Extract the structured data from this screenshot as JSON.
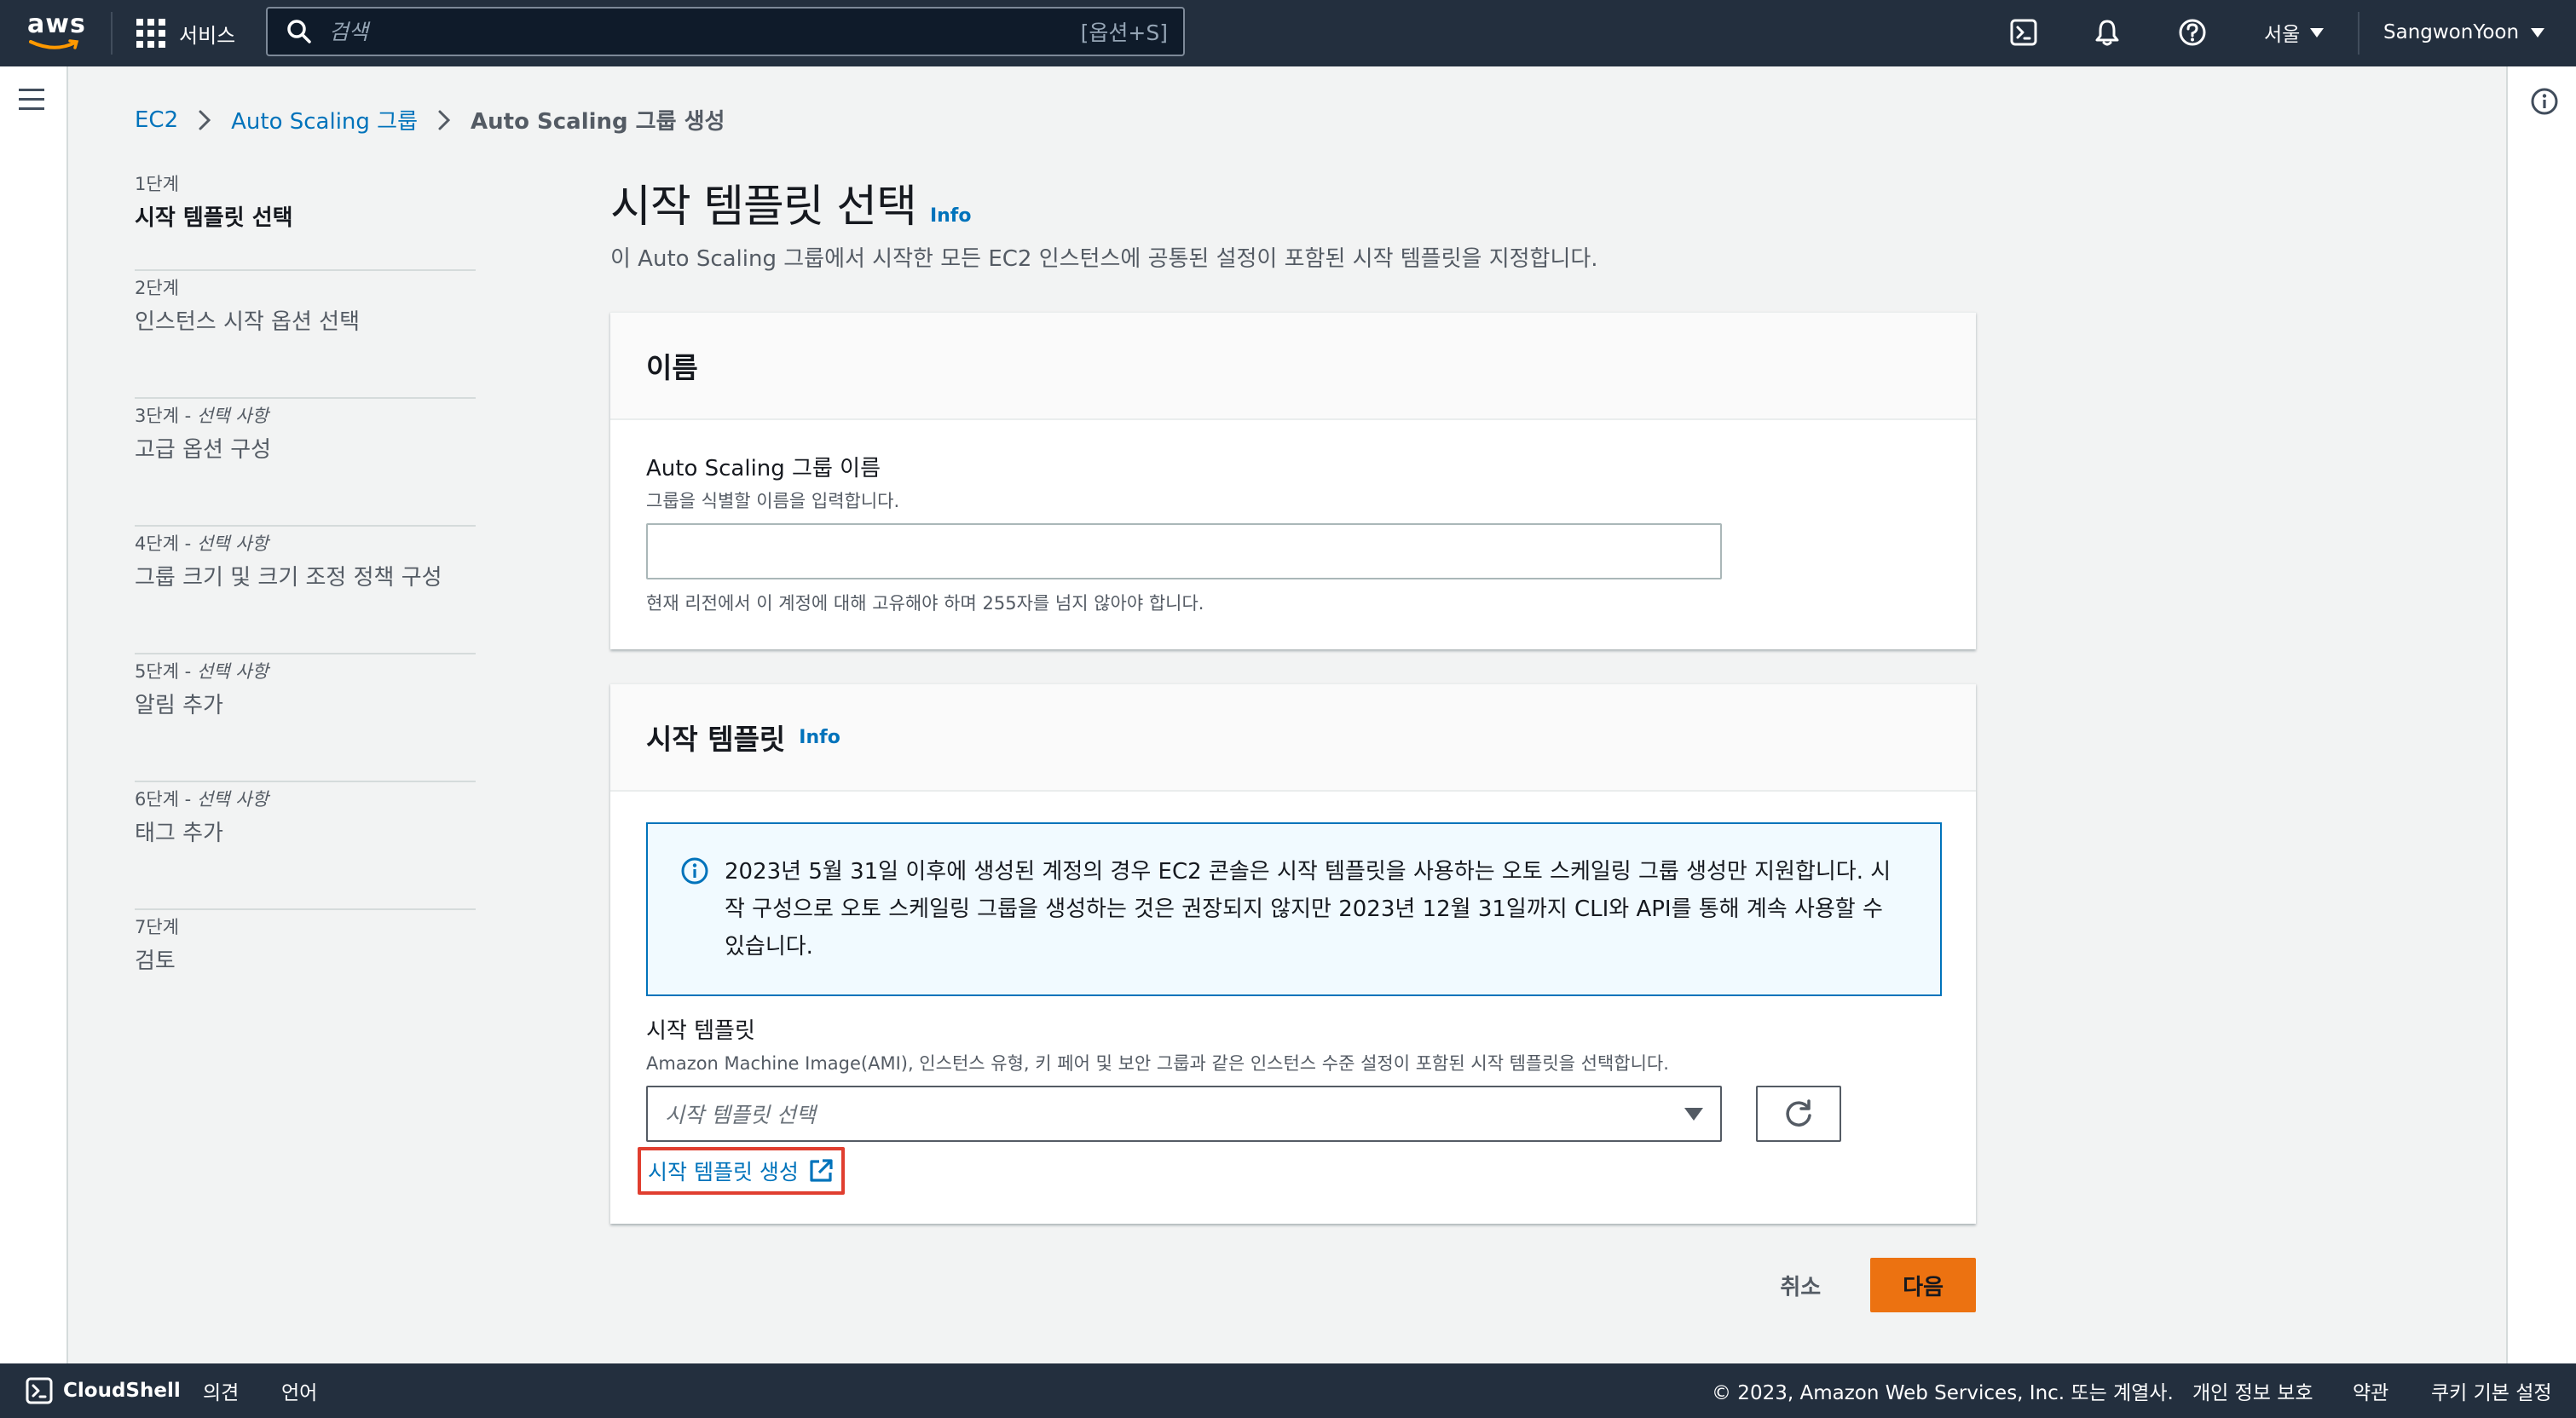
{
  "topnav": {
    "logo_text": "aws",
    "services_label": "서비스",
    "search_placeholder": "검색",
    "search_shortcut": "[옵션+S]",
    "region": "서울",
    "user": "SangwonYoon"
  },
  "breadcrumb": {
    "items": [
      "EC2",
      "Auto Scaling 그룹"
    ],
    "current": "Auto Scaling 그룹 생성"
  },
  "steps": [
    {
      "num": "1단계",
      "optional": "",
      "title": "시작 템플릿 선택"
    },
    {
      "num": "2단계",
      "optional": "",
      "title": "인스턴스 시작 옵션 선택"
    },
    {
      "num": "3단계 - ",
      "optional": "선택 사항",
      "title": "고급 옵션 구성"
    },
    {
      "num": "4단계 - ",
      "optional": "선택 사항",
      "title": "그룹 크기 및 크기 조정 정책 구성"
    },
    {
      "num": "5단계 - ",
      "optional": "선택 사항",
      "title": "알림 추가"
    },
    {
      "num": "6단계 - ",
      "optional": "선택 사항",
      "title": "태그 추가"
    },
    {
      "num": "7단계",
      "optional": "",
      "title": "검토"
    }
  ],
  "main": {
    "title": "시작 템플릿 선택",
    "info": "Info",
    "description": "이 Auto Scaling 그룹에서 시작한 모든 EC2 인스턴스에 공통된 설정이 포함된 시작 템플릿을 지정합니다."
  },
  "name_panel": {
    "header": "이름",
    "label": "Auto Scaling 그룹 이름",
    "desc": "그룹을 식별할 이름을 입력합니다.",
    "value": "",
    "constraint": "현재 리전에서 이 계정에 대해 고유해야 하며 255자를 넘지 않아야 합니다."
  },
  "template_panel": {
    "header": "시작 템플릿",
    "info": "Info",
    "alert": "2023년 5월 31일 이후에 생성된 계정의 경우 EC2 콘솔은 시작 템플릿을 사용하는 오토 스케일링 그룹 생성만 지원합니다. 시작 구성으로 오토 스케일링 그룹을 생성하는 것은 권장되지 않지만 2023년 12월 31일까지 CLI와 API를 통해 계속 사용할 수 있습니다.",
    "label": "시작 템플릿",
    "desc": "Amazon Machine Image(AMI), 인스턴스 유형, 키 페어 및 보안 그룹과 같은 인스턴스 수준 설정이 포함된 시작 템플릿을 선택합니다.",
    "select_placeholder": "시작 템플릿 선택",
    "create_link": "시작 템플릿 생성"
  },
  "actions": {
    "cancel": "취소",
    "next": "다음"
  },
  "footer": {
    "cloudshell": "CloudShell",
    "feedback": "의견",
    "language": "언어",
    "copyright": "© 2023, Amazon Web Services, Inc. 또는 계열사.",
    "privacy": "개인 정보 보호",
    "terms": "약관",
    "cookies": "쿠키 기본 설정"
  },
  "colors": {
    "nav_bg": "#232f3e",
    "link": "#0073bb",
    "primary_button": "#ec7211",
    "highlight_border": "#e03e2f",
    "alert_border": "#0073bb",
    "alert_bg": "#f1faff"
  }
}
